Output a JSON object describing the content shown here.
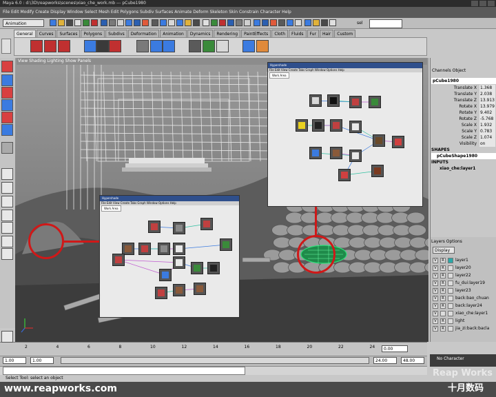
{
  "window": {
    "title": "Maya 6.0 : d:\\3D\\reapworks\\scenes\\xiao_che_work.mb --- pCube1980"
  },
  "menubar": {
    "items": "File  Edit  Modify  Create  Display  Window  Select  Mesh  Edit Polygons  Subdiv Surfaces  Animate  Deform  Skeleton  Skin  Constrain  Character  Help"
  },
  "status_line": {
    "mode": "Animation",
    "sel_label": "sel"
  },
  "shelf": {
    "tabs": [
      "General",
      "Curves",
      "Surfaces",
      "Polygons",
      "Subdivs",
      "Deformation",
      "Animation",
      "Dynamics",
      "Rendering",
      "PaintEffects",
      "Cloth",
      "Fluids",
      "Fur",
      "Hair",
      "Custom"
    ],
    "active_tab": "General"
  },
  "viewport": {
    "menu": "View  Shading  Lighting  Show  Panels"
  },
  "channel_box": {
    "header": "Channels  Object",
    "object": "pCube1980",
    "attributes": [
      {
        "name": "Translate X",
        "value": "1.368"
      },
      {
        "name": "Translate Y",
        "value": "2.038"
      },
      {
        "name": "Translate Z",
        "value": "13.913"
      },
      {
        "name": "Rotate X",
        "value": "13.979"
      },
      {
        "name": "Rotate Y",
        "value": "9.402"
      },
      {
        "name": "Rotate Z",
        "value": "-5.768"
      },
      {
        "name": "Scale X",
        "value": "1.932"
      },
      {
        "name": "Scale Y",
        "value": "0.783"
      },
      {
        "name": "Scale Z",
        "value": "1.074"
      },
      {
        "name": "Visibility",
        "value": "on"
      }
    ],
    "shapes_label": "SHAPES",
    "shape_name": "pCubeShape1980",
    "inputs_label": "INPUTS",
    "input_name": "xiao_che:layer1"
  },
  "layer_editor": {
    "header": "Layers  Options",
    "display": "Display",
    "layers": [
      {
        "v": "V",
        "r": "R",
        "name": "layer1"
      },
      {
        "v": "V",
        "r": "R",
        "name": "layer20"
      },
      {
        "v": "V",
        "r": "R",
        "name": "layer22"
      },
      {
        "v": "V",
        "r": "R",
        "name": "fu_dui:layer19"
      },
      {
        "v": "V",
        "r": "R",
        "name": "layer23"
      },
      {
        "v": "V",
        "r": "R",
        "name": "back:bao_chuan"
      },
      {
        "v": "V",
        "r": "R",
        "name": "back:layer24"
      },
      {
        "v": "V",
        "r": "",
        "name": "xiao_che:layer1"
      },
      {
        "v": "V",
        "r": "R",
        "name": "light"
      },
      {
        "v": "V",
        "r": "R",
        "name": "jia_zi:back:bacla"
      }
    ]
  },
  "time_slider": {
    "ticks": [
      "2",
      "4",
      "6",
      "8",
      "10",
      "12",
      "14",
      "16",
      "18",
      "20",
      "22",
      "24"
    ],
    "current_frame": "0.00"
  },
  "range": {
    "start": "1.00",
    "start_inner": "1.00",
    "end_inner": "24.00",
    "end": "48.00"
  },
  "character": {
    "label": "No Character"
  },
  "help_line": {
    "text": "Select Tool: select an object"
  },
  "hypershade_top": {
    "title": "Hypershade",
    "menu": "File  Edit  View  Create  Tabs  Graph  Window  Options  Help",
    "tab": "Work Area"
  },
  "hypershade_mid": {
    "title": "Hypershade",
    "menu": "File  Edit  View  Create  Tabs  Graph  Window  Options  Help",
    "tab": "Work Area"
  },
  "watermark": {
    "site": "www.reapworks.com",
    "brand": "Reap Works",
    "brand_cn": "十月数码"
  },
  "colors": {
    "highlight_circle": "#d01818",
    "selection_green": "#2ee07a"
  }
}
